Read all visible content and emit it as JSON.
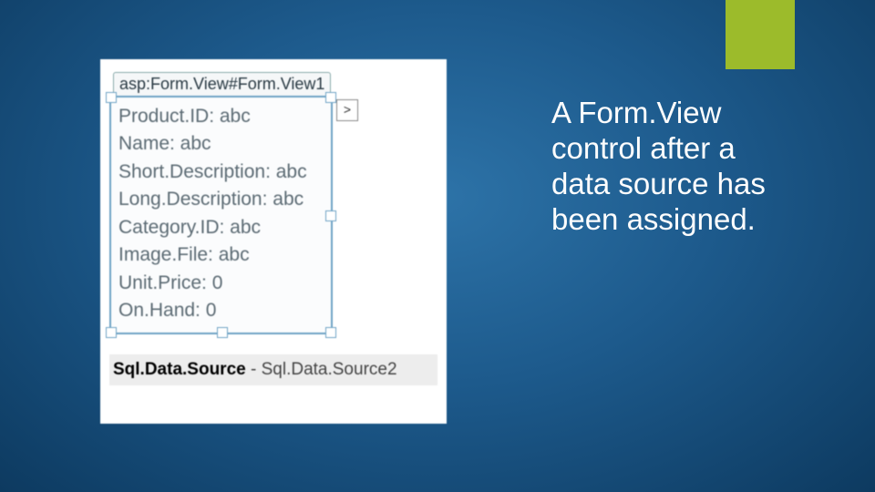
{
  "accent_color": "#9cbb2b",
  "caption": "A Form.View control after a data source has been assigned.",
  "designer": {
    "control_tag": "asp:Form.View#Form.View1",
    "fields": [
      {
        "label": "Product.ID",
        "value": "abc"
      },
      {
        "label": "Name",
        "value": "abc"
      },
      {
        "label": "Short.Description",
        "value": "abc"
      },
      {
        "label": "Long.Description",
        "value": "abc"
      },
      {
        "label": "Category.ID",
        "value": "abc"
      },
      {
        "label": "Image.File",
        "value": "abc"
      },
      {
        "label": "Unit.Price",
        "value": "0"
      },
      {
        "label": "On.Hand",
        "value": "0"
      }
    ],
    "smarttag_glyph": ">",
    "datasource_label_bold": "Sql.Data.Source",
    "datasource_label_rest": " - Sql.Data.Source2"
  }
}
